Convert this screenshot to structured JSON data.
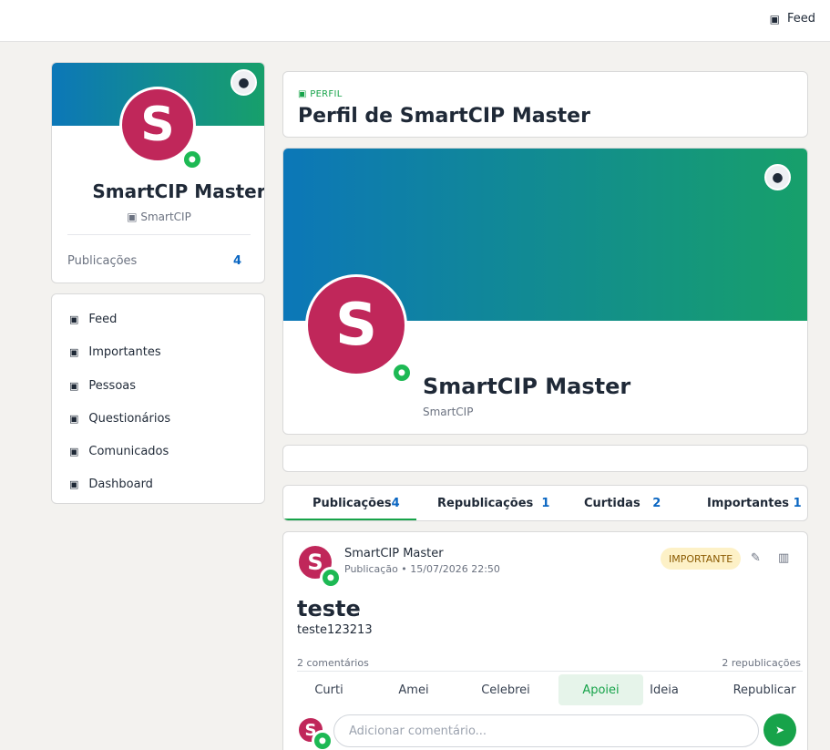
{
  "topbar": {
    "feed_icon": "▣",
    "feed_label": "Feed"
  },
  "left_profile": {
    "cam_icon": "●",
    "avatar_letter": "S",
    "name": "SmartCIP Master",
    "org_icon": "▣",
    "org": "SmartCIP",
    "publications_label": "Publicações",
    "publications_count": "4"
  },
  "nav": {
    "icon": "▣",
    "items": [
      {
        "label": "Feed"
      },
      {
        "label": "Importantes"
      },
      {
        "label": "Pessoas"
      },
      {
        "label": "Questionários"
      },
      {
        "label": "Comunicados"
      },
      {
        "label": "Dashboard"
      }
    ]
  },
  "header": {
    "kicker_icon": "▣",
    "kicker": "PERFIL",
    "title": "Perfil de SmartCIP Master"
  },
  "profile": {
    "cam_icon": "●",
    "avatar_letter": "S",
    "name": "SmartCIP Master",
    "org": "SmartCIP"
  },
  "tabs": [
    {
      "label": "Publicações",
      "count": "4"
    },
    {
      "label": "Republicações",
      "count": "1"
    },
    {
      "label": "Curtidas",
      "count": "2"
    },
    {
      "label": "Importantes",
      "count": "1"
    }
  ],
  "post": {
    "avatar_letter": "S",
    "author": "SmartCIP Master",
    "meta": "Publicação • 15/07/2026 22:50",
    "badge": "IMPORTANTE",
    "edit_icon": "✎",
    "delete_icon": "▥",
    "title": "teste",
    "body": "teste123213",
    "comments": "2 comentários",
    "reposts": "2 republicações",
    "reactions": [
      "Curti",
      "Amei",
      "Celebrei",
      "Apoiei",
      "Ideia",
      "Republicar"
    ],
    "comment_placeholder": "Adicionar comentário...",
    "send_icon": "➤"
  },
  "colors": {
    "accent": "#17a34a",
    "link": "#0a66c2",
    "avatar": "#c0275a",
    "banner_start": "#0c77b8",
    "banner_end": "#17a06a"
  }
}
